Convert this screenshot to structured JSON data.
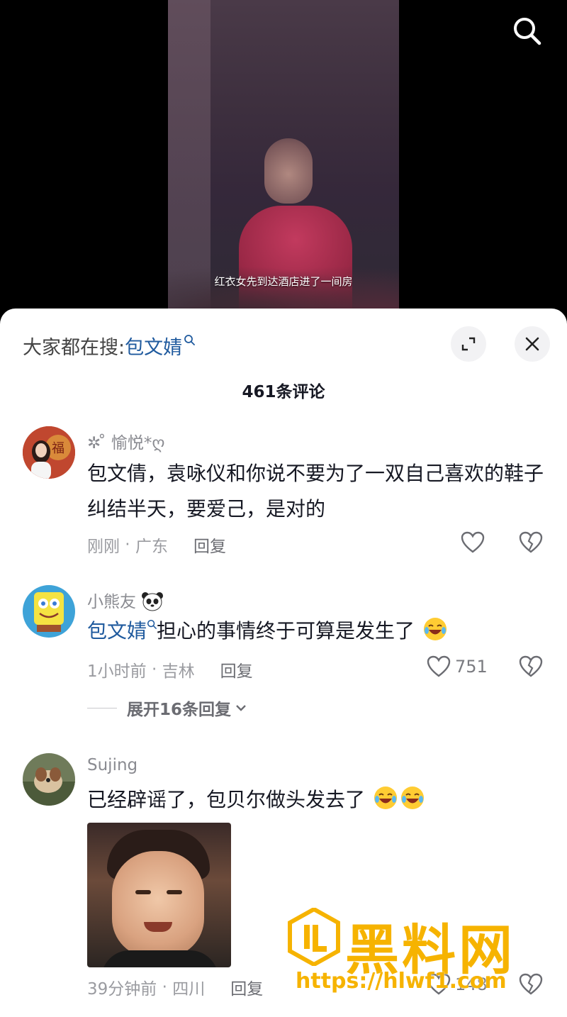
{
  "video": {
    "caption": "红衣女先到达酒店进了一间房"
  },
  "sheet": {
    "trending_prefix": "大家都在搜:",
    "trending_term": "包文婧",
    "comment_count_label": "461条评论"
  },
  "comments": [
    {
      "username": "✲ ̊ 愉悦*ღ",
      "text": "包文倩，袁咏仪和你说不要为了一双自己喜欢的鞋子纠结半天，要爱己，是对的",
      "time": "刚刚",
      "location": "广东",
      "reply_label": "回复",
      "likes": ""
    },
    {
      "username": "小熊友",
      "mention": "包文婧",
      "text": "担心的事情终于可算是发生了",
      "time": "1小时前",
      "location": "吉林",
      "reply_label": "回复",
      "likes": "751",
      "expand_label": "展开16条回复"
    },
    {
      "username": "Sujing",
      "text": "已经辟谣了，包贝尔做头发去了",
      "time": "39分钟前",
      "location": "四川",
      "reply_label": "回复",
      "likes": "148"
    }
  ],
  "watermark": {
    "title": "黑料网",
    "url": "https://hlwf1.com"
  },
  "colors": {
    "link_blue": "#1f5a9e",
    "watermark_gold": "#f6b300"
  },
  "icons": [
    "search-icon",
    "expand-icon",
    "close-icon",
    "heart-icon",
    "broken-heart-icon",
    "chevron-down-icon",
    "mini-search-icon",
    "panda-emoji",
    "laugh-cry-emoji"
  ]
}
